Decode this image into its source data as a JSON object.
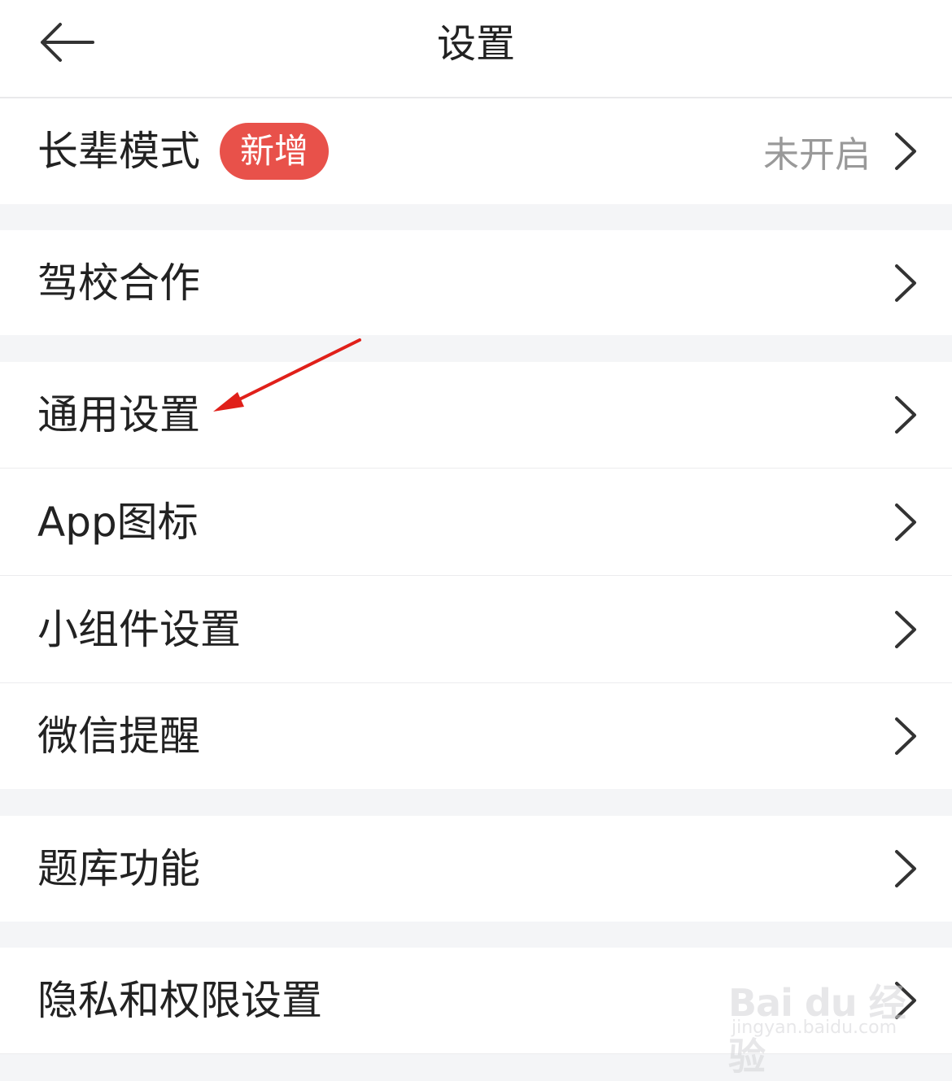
{
  "header": {
    "title": "设置",
    "back_icon": "arrow-left-icon"
  },
  "accent_colors": {
    "badge": "#e8514a",
    "arrow": "#e0201a"
  },
  "rows": [
    {
      "label": "长辈模式",
      "badge": "新增",
      "status": "未开启"
    },
    {
      "label": "驾校合作"
    },
    {
      "label": "通用设置"
    },
    {
      "label": "App图标"
    },
    {
      "label": "小组件设置"
    },
    {
      "label": "微信提醒"
    },
    {
      "label": "题库功能"
    },
    {
      "label": "隐私和权限设置"
    }
  ],
  "watermark": {
    "brand": "Bai du 经验",
    "url": "jingyan.baidu.com"
  }
}
